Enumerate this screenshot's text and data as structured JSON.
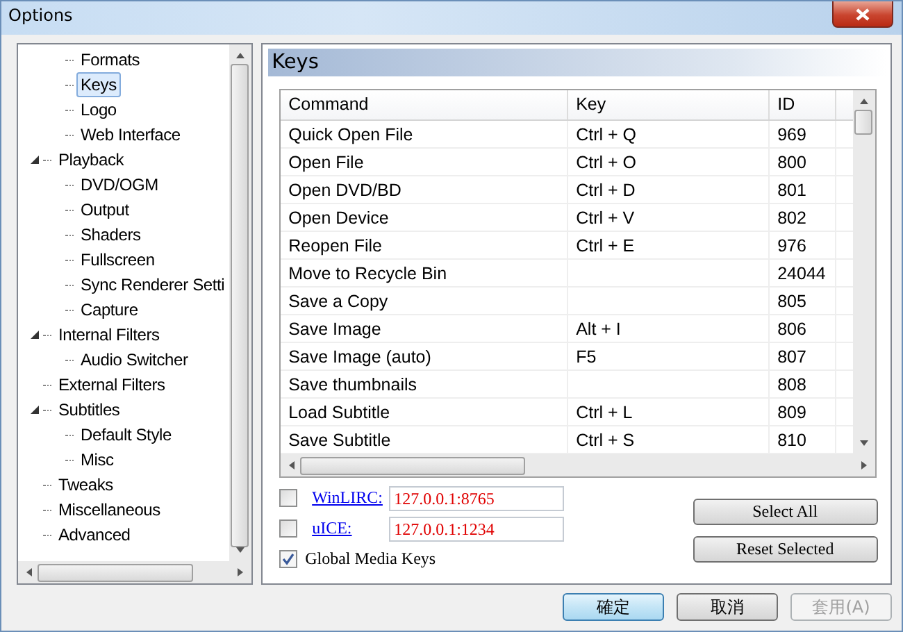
{
  "window": {
    "title": "Options"
  },
  "tree": {
    "items": [
      {
        "children": [
          {
            "label": "Formats",
            "selected": false
          },
          {
            "label": "Keys",
            "selected": true
          },
          {
            "label": "Logo",
            "selected": false
          },
          {
            "label": "Web Interface",
            "selected": false
          }
        ]
      },
      {
        "label": "Playback",
        "selected": false,
        "expanded": true,
        "children": [
          {
            "label": "DVD/OGM",
            "selected": false
          },
          {
            "label": "Output",
            "selected": false
          },
          {
            "label": "Shaders",
            "selected": false
          },
          {
            "label": "Fullscreen",
            "selected": false
          },
          {
            "label": "Sync Renderer Setti",
            "selected": false
          },
          {
            "label": "Capture",
            "selected": false
          }
        ]
      },
      {
        "label": "Internal Filters",
        "selected": false,
        "expanded": true,
        "children": [
          {
            "label": "Audio Switcher",
            "selected": false
          }
        ]
      },
      {
        "label": "External Filters",
        "selected": false
      },
      {
        "label": "Subtitles",
        "selected": false,
        "expanded": true,
        "children": [
          {
            "label": "Default Style",
            "selected": false
          },
          {
            "label": "Misc",
            "selected": false
          }
        ]
      },
      {
        "label": "Tweaks",
        "selected": false
      },
      {
        "label": "Miscellaneous",
        "selected": false
      },
      {
        "label": "Advanced",
        "selected": false
      }
    ]
  },
  "page": {
    "title": "Keys"
  },
  "table": {
    "columns": [
      "Command",
      "Key",
      "ID"
    ],
    "rows": [
      {
        "command": "Quick Open File",
        "key": "Ctrl + Q",
        "id": "969"
      },
      {
        "command": "Open File",
        "key": "Ctrl + O",
        "id": "800"
      },
      {
        "command": "Open DVD/BD",
        "key": "Ctrl + D",
        "id": "801"
      },
      {
        "command": "Open Device",
        "key": "Ctrl + V",
        "id": "802"
      },
      {
        "command": "Reopen File",
        "key": "Ctrl + E",
        "id": "976"
      },
      {
        "command": "Move to Recycle Bin",
        "id": "24044"
      },
      {
        "command": "Save a Copy",
        "id": "805"
      },
      {
        "command": "Save Image",
        "key": "Alt + I",
        "id": "806"
      },
      {
        "command": "Save Image (auto)",
        "key": "F5",
        "id": "807"
      },
      {
        "command": "Save thumbnails",
        "id": "808"
      },
      {
        "command": "Load Subtitle",
        "key": "Ctrl + L",
        "id": "809"
      },
      {
        "command": "Save Subtitle",
        "key": "Ctrl + S",
        "id": "810"
      }
    ]
  },
  "remotes": [
    {
      "kind": "link",
      "checked": false,
      "label": "WinLIRC:",
      "value": "127.0.0.1:8765"
    },
    {
      "kind": "link",
      "checked": false,
      "label": "uICE:",
      "value": "127.0.0.1:1234"
    },
    {
      "kind": "plain",
      "checked": true,
      "label": "Global Media Keys"
    }
  ],
  "actions": [
    "Select All",
    "Reset Selected"
  ],
  "buttons": [
    {
      "label": "確定",
      "default": true,
      "disabled": false
    },
    {
      "label": "取消",
      "default": false,
      "disabled": false
    },
    {
      "label": "套用(A)",
      "default": false,
      "disabled": true
    }
  ]
}
